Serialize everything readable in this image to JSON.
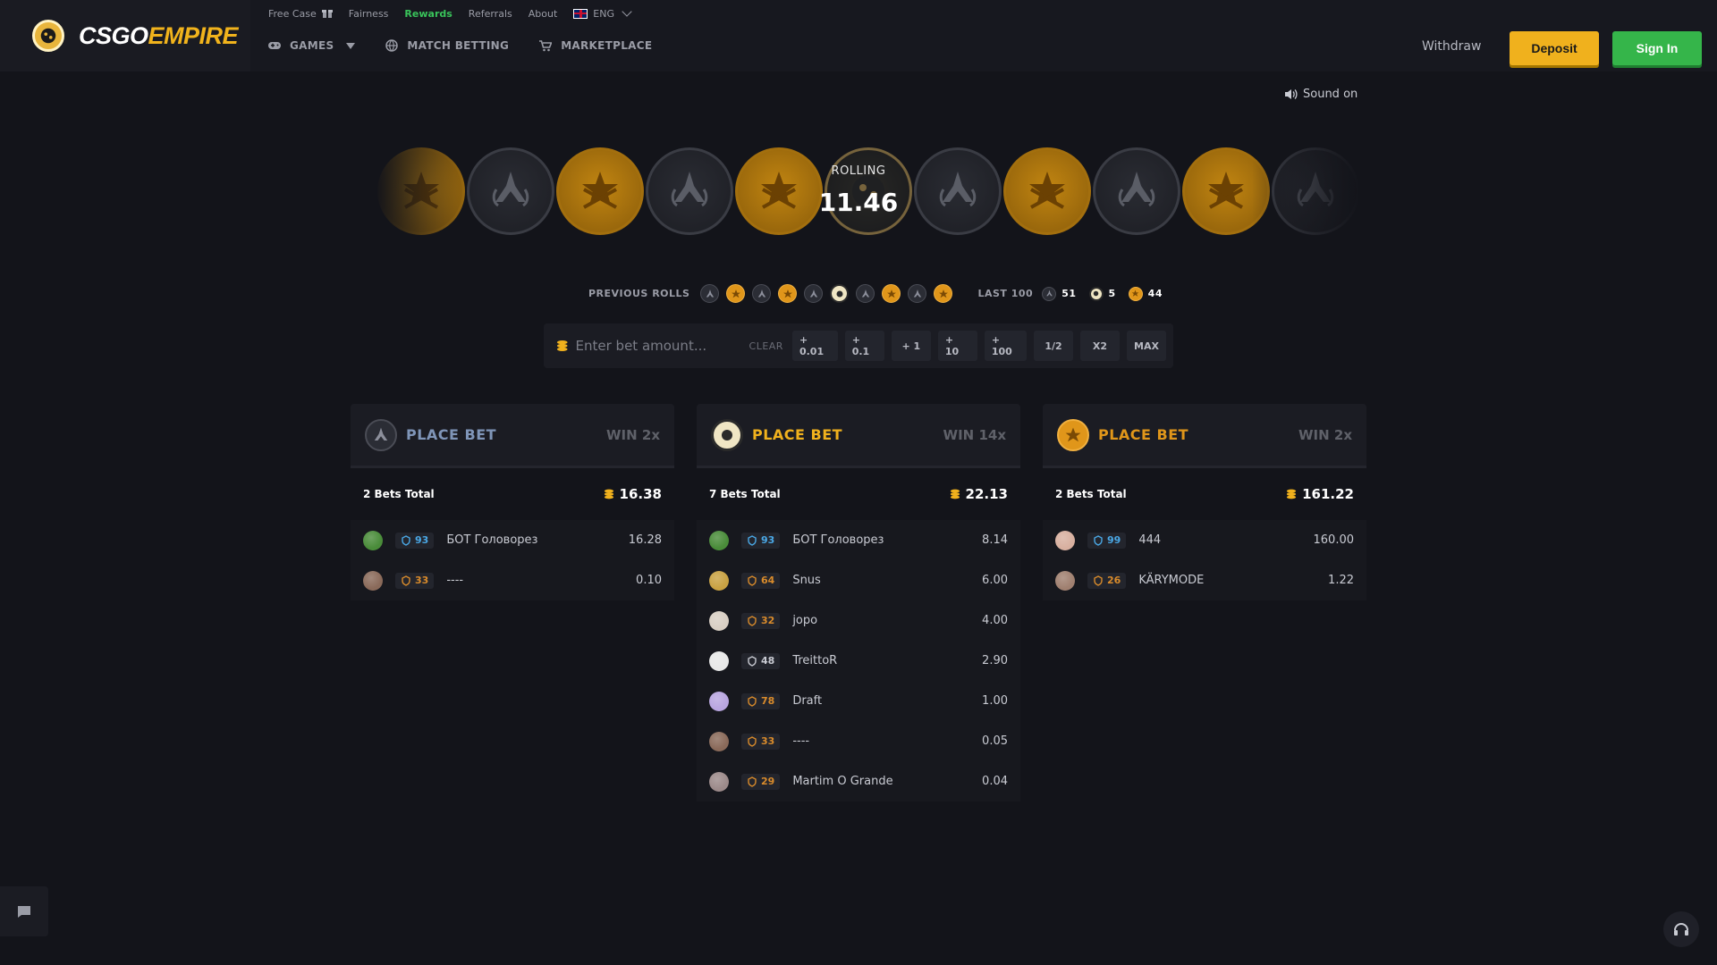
{
  "brand": {
    "name_main": "CSGO",
    "name_accent": "EMPIRE"
  },
  "topnav": [
    {
      "label": "Free Case",
      "icon": "gift-icon"
    },
    {
      "label": "Fairness"
    },
    {
      "label": "Rewards",
      "active": true
    },
    {
      "label": "Referrals"
    },
    {
      "label": "About"
    },
    {
      "label": "ENG",
      "icon": "uk-flag-icon"
    }
  ],
  "mainnav": [
    {
      "label": "GAMES",
      "icon": "gamepad-icon"
    },
    {
      "label": "MATCH BETTING",
      "icon": "globe-icon"
    },
    {
      "label": "MARKETPLACE",
      "icon": "cart-icon"
    }
  ],
  "header_actions": {
    "withdraw": "Withdraw",
    "deposit": "Deposit",
    "signin": "Sign In"
  },
  "sound": "Sound on",
  "roll": {
    "label": "ROLLING",
    "value": "11.46"
  },
  "strip": [
    "t",
    "ct",
    "t",
    "ct",
    "t",
    "dice",
    "ct",
    "t",
    "ct",
    "t",
    "ct"
  ],
  "previous": {
    "label": "PREVIOUS ROLLS",
    "rolls": [
      "ct",
      "t",
      "ct",
      "t",
      "ct",
      "dice",
      "ct",
      "t",
      "ct",
      "t"
    ],
    "last100_label": "LAST 100",
    "last100": {
      "ct": "51",
      "dice": "5",
      "t": "44"
    }
  },
  "betbar": {
    "placeholder": "Enter bet amount...",
    "clear": "CLEAR",
    "buttons": [
      "+ 0.01",
      "+ 0.1",
      "+ 1",
      "+ 10",
      "+ 100",
      "1/2",
      "X2",
      "MAX"
    ]
  },
  "colors": {
    "ct": "#7f95b8",
    "dice": "#f0b11d",
    "t": "#e0961a",
    "green": "#35b54a",
    "level_blue": "#4aa8e6",
    "level_orange": "#d98b2b"
  },
  "panels": [
    {
      "side": "ct",
      "place": "PLACE BET",
      "win": "WIN 2x",
      "total_label": "2 Bets Total",
      "total": "16.38",
      "bets": [
        {
          "name": "БОТ Головорез",
          "level": "93",
          "tier": "blue",
          "amount": "16.28",
          "avatar": "#4a8c3a"
        },
        {
          "name": "----",
          "level": "33",
          "tier": "orange",
          "amount": "0.10",
          "avatar": "#8a6a5a"
        }
      ]
    },
    {
      "side": "dice",
      "place": "PLACE BET",
      "win": "WIN 14x",
      "total_label": "7 Bets Total",
      "total": "22.13",
      "bets": [
        {
          "name": "БОТ Головорез",
          "level": "93",
          "tier": "blue",
          "amount": "8.14",
          "avatar": "#4a8c3a"
        },
        {
          "name": "Snus",
          "level": "64",
          "tier": "orange",
          "amount": "6.00",
          "avatar": "#c9a243"
        },
        {
          "name": "jopo",
          "level": "32",
          "tier": "orange",
          "amount": "4.00",
          "avatar": "#d9cfc4"
        },
        {
          "name": "TreittoR",
          "level": "48",
          "tier": "grey",
          "amount": "2.90",
          "avatar": "#e8e8e8"
        },
        {
          "name": "Draft",
          "level": "78",
          "tier": "orange",
          "amount": "1.00",
          "avatar": "#b9a6e0"
        },
        {
          "name": "----",
          "level": "33",
          "tier": "orange",
          "amount": "0.05",
          "avatar": "#8a6a5a"
        },
        {
          "name": "Martim O Grande",
          "level": "29",
          "tier": "orange",
          "amount": "0.04",
          "avatar": "#9c8a8a"
        }
      ]
    },
    {
      "side": "t",
      "place": "PLACE BET",
      "win": "WIN 2x",
      "total_label": "2 Bets Total",
      "total": "161.22",
      "bets": [
        {
          "name": "444",
          "level": "99",
          "tier": "blue",
          "amount": "160.00",
          "avatar": "#d8b0a0"
        },
        {
          "name": "KÄRYMODE",
          "level": "26",
          "tier": "orange",
          "amount": "1.22",
          "avatar": "#a08070"
        }
      ]
    }
  ]
}
